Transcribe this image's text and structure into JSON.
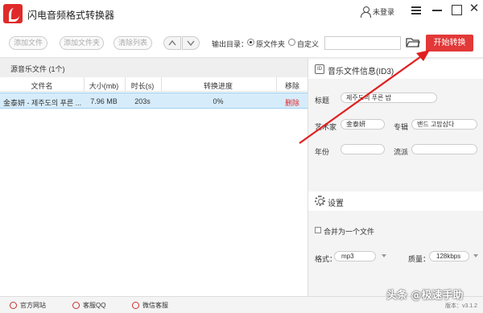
{
  "app": {
    "title": "闪电音频格式转换器"
  },
  "titlebar": {
    "login_label": "未登录"
  },
  "toolbar": {
    "add_file": "添加文件",
    "add_folder": "添加文件夹",
    "clear_list": "清除列表",
    "output_dir_label": "输出目录：",
    "option_original": "原文件夹",
    "option_custom": "自定义",
    "output_path": "",
    "start_button": "开始转换"
  },
  "file_list": {
    "header": "源音乐文件 (1个)",
    "columns": [
      "文件名",
      "大小(mb)",
      "时长(s)",
      "转换进度",
      "移除"
    ],
    "rows": [
      {
        "name": "金泰妍 - 제주도의 푸른 ...",
        "size": "7.96 MB",
        "duration": "203s",
        "progress": "0%",
        "action": "删除"
      }
    ]
  },
  "id3": {
    "section_title": "音乐文件信息(ID3)",
    "badge": "ID",
    "title_label": "标题",
    "title_value": "제주도의 푸른 밤",
    "artist_label": "艺术家",
    "artist_value": "金泰妍",
    "album_label": "专辑",
    "album_value": "밴드 고맙삼다",
    "year_label": "年份",
    "year_value": "",
    "genre_label": "流派",
    "genre_value": ""
  },
  "settings": {
    "section_title": "设置",
    "merge_label": "合并为一个文件",
    "merge_checked": false,
    "format_label": "格式：",
    "format_value": "mp3",
    "quality_label": "质量：",
    "quality_value": "128kbps"
  },
  "bottombar": {
    "website": "官方网站",
    "qq": "客服QQ",
    "wechat": "微信客服",
    "version": "版本：v3.1.2"
  },
  "watermark": "头条 @极速手助",
  "colors": {
    "accent": "#e23838",
    "selection": "#d7ecfa"
  }
}
